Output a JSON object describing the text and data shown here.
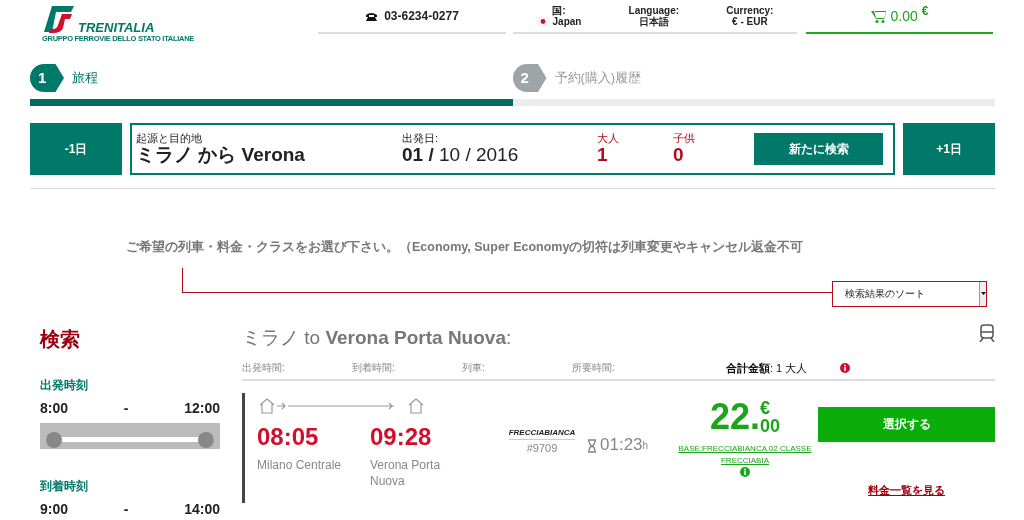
{
  "header": {
    "logo": {
      "name": "TRENITALIA",
      "tagline": "GRUPPO FERROVIE DELLO STATO ITALIANE"
    },
    "phone": "03-6234-0277",
    "locale": [
      {
        "label": "国:",
        "value": "Japan",
        "kind": "flag"
      },
      {
        "label": "Language:",
        "value": "日本語",
        "kind": "text"
      },
      {
        "label": "Currency:",
        "value": "€ - EUR",
        "kind": "text"
      }
    ],
    "cart": {
      "amount": "0.00",
      "currency": "€"
    }
  },
  "steps": [
    {
      "number": "1",
      "label": "旅程",
      "selected": true
    },
    {
      "number": "2",
      "label": "予約(購入)履歴",
      "selected": false
    }
  ],
  "search_bar": {
    "prev_day": "-1日",
    "route_label": "起源と目的地",
    "route": "ミラノ から Verona",
    "date_label": "出発日:",
    "date": "**01 /** 10 / 2016",
    "adults_label": "大人",
    "adults": "1",
    "children_label": "子供",
    "children": "0",
    "new_search": "新たに検索",
    "next_day": "+1日"
  },
  "instruction": "ご希望の列車・料金・クラスをお選び下さい。（Economy, Super Economyの切符は列車変更やキャンセル返金不可",
  "sort_select": {
    "value": "検索結果のソート"
  },
  "sidebar": {
    "title": "検索",
    "filters": [
      {
        "label": "出発時刻",
        "from": "8:00",
        "separator": "-",
        "to": "12:00",
        "level": 1
      },
      {
        "label": "到着時刻",
        "from": "9:00",
        "separator": "-",
        "to": "14:00"
      }
    ]
  },
  "results": {
    "title": "ミラノ to **Verona Porta Nuova**:",
    "columns": [
      "出発時間:",
      "到着時間:",
      "列車:",
      "所要時間:"
    ],
    "total": "**合計金額**: 1 大人",
    "rows": [
      {
        "departure": "08:05",
        "departure_station": "Milano Centrale",
        "arrival": "09:28",
        "arrival_station": "Verona Porta Nuova",
        "train_brand": "FRECCIABIANCA",
        "train_number": "#9709",
        "duration": "01:23",
        "duration_unit": "h",
        "price": "22.",
        "price_cents": "00",
        "currency": "€",
        "fare": "BASE:FRECCIABIANCA 02 CLASSE FRECCIABIA",
        "select": "選択する",
        "more": "料金一覧を見る"
      }
    ]
  }
}
